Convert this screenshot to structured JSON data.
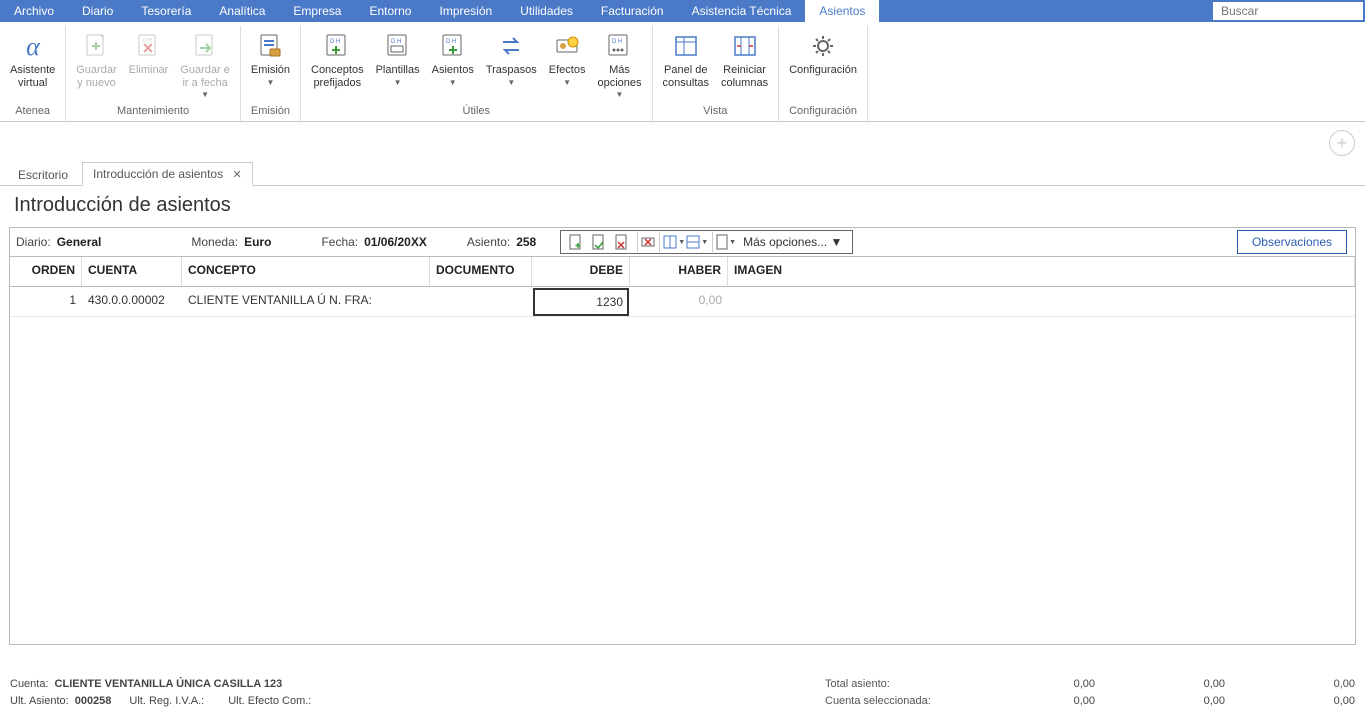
{
  "menu": {
    "items": [
      "Archivo",
      "Diario",
      "Tesorería",
      "Analítica",
      "Empresa",
      "Entorno",
      "Impresión",
      "Utilidades",
      "Facturación",
      "Asistencia Técnica",
      "Asientos"
    ],
    "active_index": 10,
    "search_placeholder": "Buscar"
  },
  "ribbon": {
    "groups": [
      {
        "label": "Atenea",
        "buttons": [
          {
            "label": "Asistente\nvirtual",
            "icon": "alpha-icon",
            "interact": true
          }
        ]
      },
      {
        "label": "Mantenimiento",
        "buttons": [
          {
            "label": "Guardar\ny nuevo",
            "icon": "doc-plus-icon",
            "interact": false,
            "disabled": true
          },
          {
            "label": "Eliminar",
            "icon": "doc-x-icon",
            "interact": false,
            "disabled": true
          },
          {
            "label": "Guardar e\nir a fecha",
            "icon": "doc-arrow-icon",
            "interact": false,
            "disabled": true,
            "dropdown": true
          }
        ]
      },
      {
        "label": "Emisión",
        "buttons": [
          {
            "label": "Emisión",
            "icon": "doc-print-icon",
            "interact": true,
            "dropdown": true
          }
        ]
      },
      {
        "label": "Útiles",
        "buttons": [
          {
            "label": "Conceptos\nprefijados",
            "icon": "dh-plus-icon",
            "interact": true
          },
          {
            "label": "Plantillas",
            "icon": "dh-template-icon",
            "interact": true,
            "dropdown": true
          },
          {
            "label": "Asientos",
            "icon": "dh-asientos-icon",
            "interact": true,
            "dropdown": true
          },
          {
            "label": "Traspasos",
            "icon": "traspasos-icon",
            "interact": true,
            "dropdown": true
          },
          {
            "label": "Efectos",
            "icon": "efectos-icon",
            "interact": true,
            "dropdown": true
          },
          {
            "label": "Más\nopciones",
            "icon": "dh-more-icon",
            "interact": true,
            "dropdown": true
          }
        ]
      },
      {
        "label": "Vista",
        "buttons": [
          {
            "label": "Panel de\nconsultas",
            "icon": "panel-icon",
            "interact": true
          },
          {
            "label": "Reiniciar\ncolumnas",
            "icon": "columns-icon",
            "interact": true
          }
        ]
      },
      {
        "label": "Configuración",
        "buttons": [
          {
            "label": "Configuración",
            "icon": "gear-icon",
            "interact": true
          }
        ]
      }
    ]
  },
  "tabs": {
    "items": [
      {
        "label": "Escritorio",
        "active": false,
        "closable": false
      },
      {
        "label": "Introducción de asientos",
        "active": true,
        "closable": true
      }
    ]
  },
  "page": {
    "title": "Introducción de asientos"
  },
  "infobar": {
    "diario_label": "Diario:",
    "diario_value": "General",
    "moneda_label": "Moneda:",
    "moneda_value": "Euro",
    "fecha_label": "Fecha:",
    "fecha_value": "01/06/20XX",
    "asiento_label": "Asiento:",
    "asiento_value": "258",
    "more_options": "Más opciones...",
    "observaciones": "Observaciones"
  },
  "grid": {
    "headers": {
      "orden": "ORDEN",
      "cuenta": "CUENTA",
      "concepto": "CONCEPTO",
      "documento": "DOCUMENTO",
      "debe": "DEBE",
      "haber": "HABER",
      "imagen": "IMAGEN"
    },
    "rows": [
      {
        "orden": "1",
        "cuenta": "430.0.0.00002",
        "concepto": "CLIENTE VENTANILLA Ú N. FRA:",
        "documento": "",
        "debe": "1230",
        "haber": "0,00",
        "imagen": "",
        "editing_field": "debe"
      }
    ]
  },
  "status": {
    "cuenta_label": "Cuenta:",
    "cuenta_value": "CLIENTE VENTANILLA ÚNICA CASILLA 123",
    "ult_asiento_label": "Ult. Asiento:",
    "ult_asiento_value": "000258",
    "ult_reg_iva_label": "Ult. Reg. I.V.A.:",
    "ult_reg_iva_value": "",
    "ult_efecto_label": "Ult. Efecto Com.:",
    "ult_efecto_value": "",
    "totals": {
      "row1_label": "Total asiento:",
      "row2_label": "Cuenta seleccionada:",
      "v11": "0,00",
      "v12": "0,00",
      "v13": "0,00",
      "v21": "0,00",
      "v22": "0,00",
      "v23": "0,00"
    }
  }
}
